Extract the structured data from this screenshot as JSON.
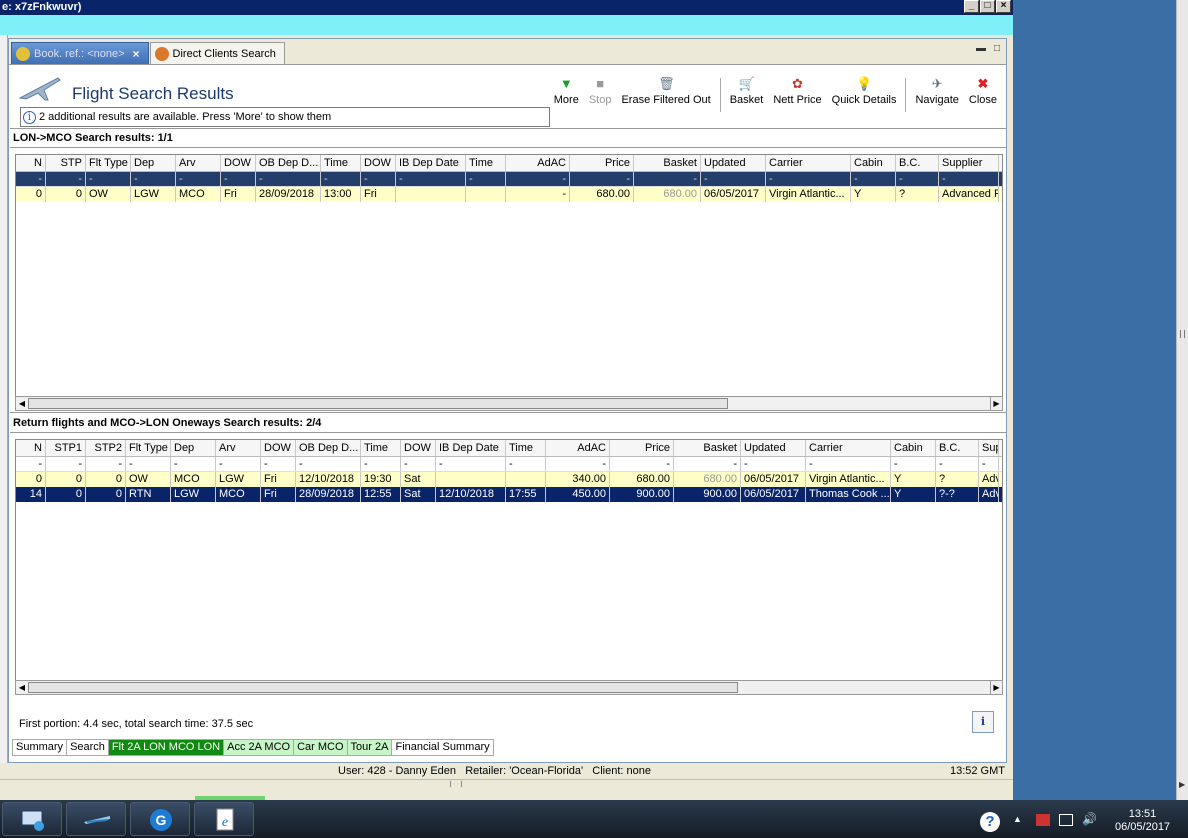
{
  "window": {
    "title": "e: x7zFnkwuvr)"
  },
  "tabs": [
    {
      "label": "Book. ref.: <none>",
      "active": true
    },
    {
      "label": "Direct Clients Search",
      "active": false
    }
  ],
  "header": {
    "title": "Flight Search Results",
    "info": "2 additional results are available. Press 'More' to show them"
  },
  "toolbar": [
    {
      "label": "More",
      "icon": "filter-down-icon",
      "enabled": true
    },
    {
      "label": "Stop",
      "icon": "stop-icon",
      "enabled": false
    },
    {
      "label": "Erase Filtered Out",
      "icon": "erase-icon",
      "enabled": true
    },
    {
      "label": "Basket",
      "icon": "basket-icon",
      "enabled": true
    },
    {
      "label": "Nett Price",
      "icon": "nett-price-icon",
      "enabled": true
    },
    {
      "label": "Quick Details",
      "icon": "bulb-icon",
      "enabled": true
    },
    {
      "label": "Navigate",
      "icon": "navigate-icon",
      "enabled": true
    },
    {
      "label": "Close",
      "icon": "close-icon",
      "enabled": true
    }
  ],
  "outbound": {
    "label": "LON->MCO Search results: 1/1",
    "columns": [
      "N",
      "STP",
      "Flt Type",
      "Dep",
      "Arv",
      "DOW",
      "OB Dep D...",
      "Time",
      "DOW",
      "IB Dep Date",
      "Time",
      "AdAC",
      "Price",
      "Basket",
      "Updated",
      "Carrier",
      "Cabin",
      "B.C.",
      "Supplier"
    ],
    "filter_row": [
      "-",
      "-",
      "-",
      "-",
      "-",
      "-",
      "-",
      "-",
      "-",
      "-",
      "-",
      "-",
      "-",
      "-",
      "-",
      "-",
      "-",
      "-",
      "-"
    ],
    "rows": [
      [
        "0",
        "0",
        "OW",
        "LGW",
        "MCO",
        "Fri",
        "28/09/2018",
        "13:00",
        "Fri",
        "",
        "",
        "-",
        "680.00",
        "680.00",
        "06/05/2017",
        "Virgin Atlantic...",
        "Y",
        "?",
        "Advanced R"
      ]
    ]
  },
  "returns": {
    "label": "Return flights and MCO->LON Oneways Search results: 2/4",
    "columns": [
      "N",
      "STP1",
      "STP2",
      "Flt Type",
      "Dep",
      "Arv",
      "DOW",
      "OB Dep D...",
      "Time",
      "DOW",
      "IB Dep Date",
      "Time",
      "AdAC",
      "Price",
      "Basket",
      "Updated",
      "Carrier",
      "Cabin",
      "B.C.",
      "Sup"
    ],
    "filter_row": [
      "-",
      "-",
      "-",
      "-",
      "-",
      "-",
      "-",
      "-",
      "-",
      "-",
      "-",
      "-",
      "-",
      "-",
      "-",
      "-",
      "-",
      "-",
      "-",
      "-"
    ],
    "rows": [
      [
        "0",
        "0",
        "0",
        "OW",
        "MCO",
        "LGW",
        "Fri",
        "12/10/2018",
        "19:30",
        "Sat",
        "",
        "",
        "340.00",
        "680.00",
        "680.00",
        "06/05/2017",
        "Virgin Atlantic...",
        "Y",
        "?",
        "Adv"
      ],
      [
        "14",
        "0",
        "0",
        "RTN",
        "LGW",
        "MCO",
        "Fri",
        "28/09/2018",
        "12:55",
        "Sat",
        "12/10/2018",
        "17:55",
        "450.00",
        "900.00",
        "900.00",
        "06/05/2017",
        "Thomas Cook ...",
        "Y",
        "?-?",
        "Adv"
      ]
    ]
  },
  "footer": {
    "timing": "First portion: 4.4 sec, total search time: 37.5 sec",
    "info_button": "i"
  },
  "bottom_tabs": [
    {
      "label": "Summary",
      "style": "plain"
    },
    {
      "label": "Search",
      "style": "plain"
    },
    {
      "label": "Flt 2A LON MCO LON",
      "style": "green"
    },
    {
      "label": "Acc 2A MCO",
      "style": "light"
    },
    {
      "label": "Car MCO",
      "style": "light"
    },
    {
      "label": "Tour 2A",
      "style": "light"
    },
    {
      "label": "Financial Summary",
      "style": "plain"
    }
  ],
  "status": {
    "user": "User: 428 - Danny Eden",
    "retailer": "Retailer: 'Ocean-Florida'",
    "client": "Client: none",
    "time": "13:52 GMT"
  },
  "taskbar": {
    "clock_time": "13:51",
    "clock_date": "06/05/2017"
  }
}
